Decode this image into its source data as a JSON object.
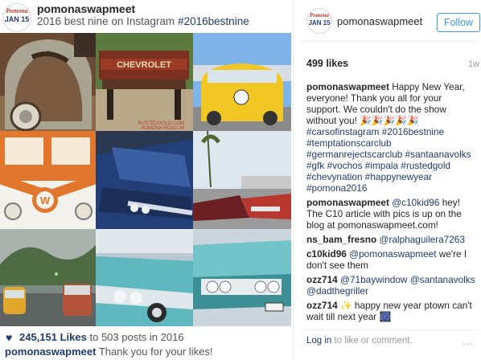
{
  "header": {
    "logo": {
      "line1": "Pomona",
      "line2": "JAN 15"
    },
    "username": "pomonaswapmeet",
    "caption": "2016 best nine on Instagram",
    "hashtag": "#2016bestnine"
  },
  "grid": {
    "tiles": [
      {
        "subject": "rusted vw bug"
      },
      {
        "subject": "chevrolet tailgate bench",
        "watermark_line1": "RUSTEDGOLD.COM",
        "watermark_line2": "POMONA ROAD 29"
      },
      {
        "subject": "yellow vw bus"
      },
      {
        "subject": "orange vw bus front"
      },
      {
        "subject": "blue impala"
      },
      {
        "subject": "lowriders parked"
      },
      {
        "subject": "vw buses in rain"
      },
      {
        "subject": "teal impala"
      },
      {
        "subject": "teal impala front"
      }
    ]
  },
  "bottom": {
    "likes_count": "245,151 Likes",
    "likes_rest": "to 503 posts in 2016",
    "caption_user": "pomonaswapmeet",
    "caption_text": "Thank you for your likes!"
  },
  "right_panel": {
    "logo": {
      "line1": "Pomona",
      "line2": "JAN 15"
    },
    "username": "pomonaswapmeet",
    "follow_label": "Follow",
    "likes": "499 likes",
    "time": "1w",
    "comments": [
      {
        "user": "pomonaswapmeet",
        "text": "Happy New Year, everyone! Thank you all for your support. We couldn't do the show without you! 🎉🎉🎉🎉🎉",
        "tags": "#carsofinstagram #2016bestnine #temptationscarclub #germanrejectscarclub #santaanavolks #gfk #vochos #impala #rustedgold #chevynation #happynewyear #pomona2016"
      },
      {
        "user": "pomonaswapmeet",
        "mention": "@c10kid96",
        "text": "hey! The C10 article with pics is up on the blog at pomonaswapmeet.com!"
      },
      {
        "user": "ns_bam_fresno",
        "mention": "@ralphaguilera7263",
        "text": ""
      },
      {
        "user": "c10kid96",
        "mention": "@pomonaswapmeet",
        "text": "we're I don't see them"
      },
      {
        "user": "ozz714",
        "mention": "@71baywindow @santanavolks @dadthegriller",
        "text": ""
      },
      {
        "user": "ozz714",
        "text": "✨ happy new year ptown can't wait till next year 🎆"
      }
    ],
    "login_link": "Log in",
    "login_rest": "to like or comment.",
    "more": "..."
  }
}
